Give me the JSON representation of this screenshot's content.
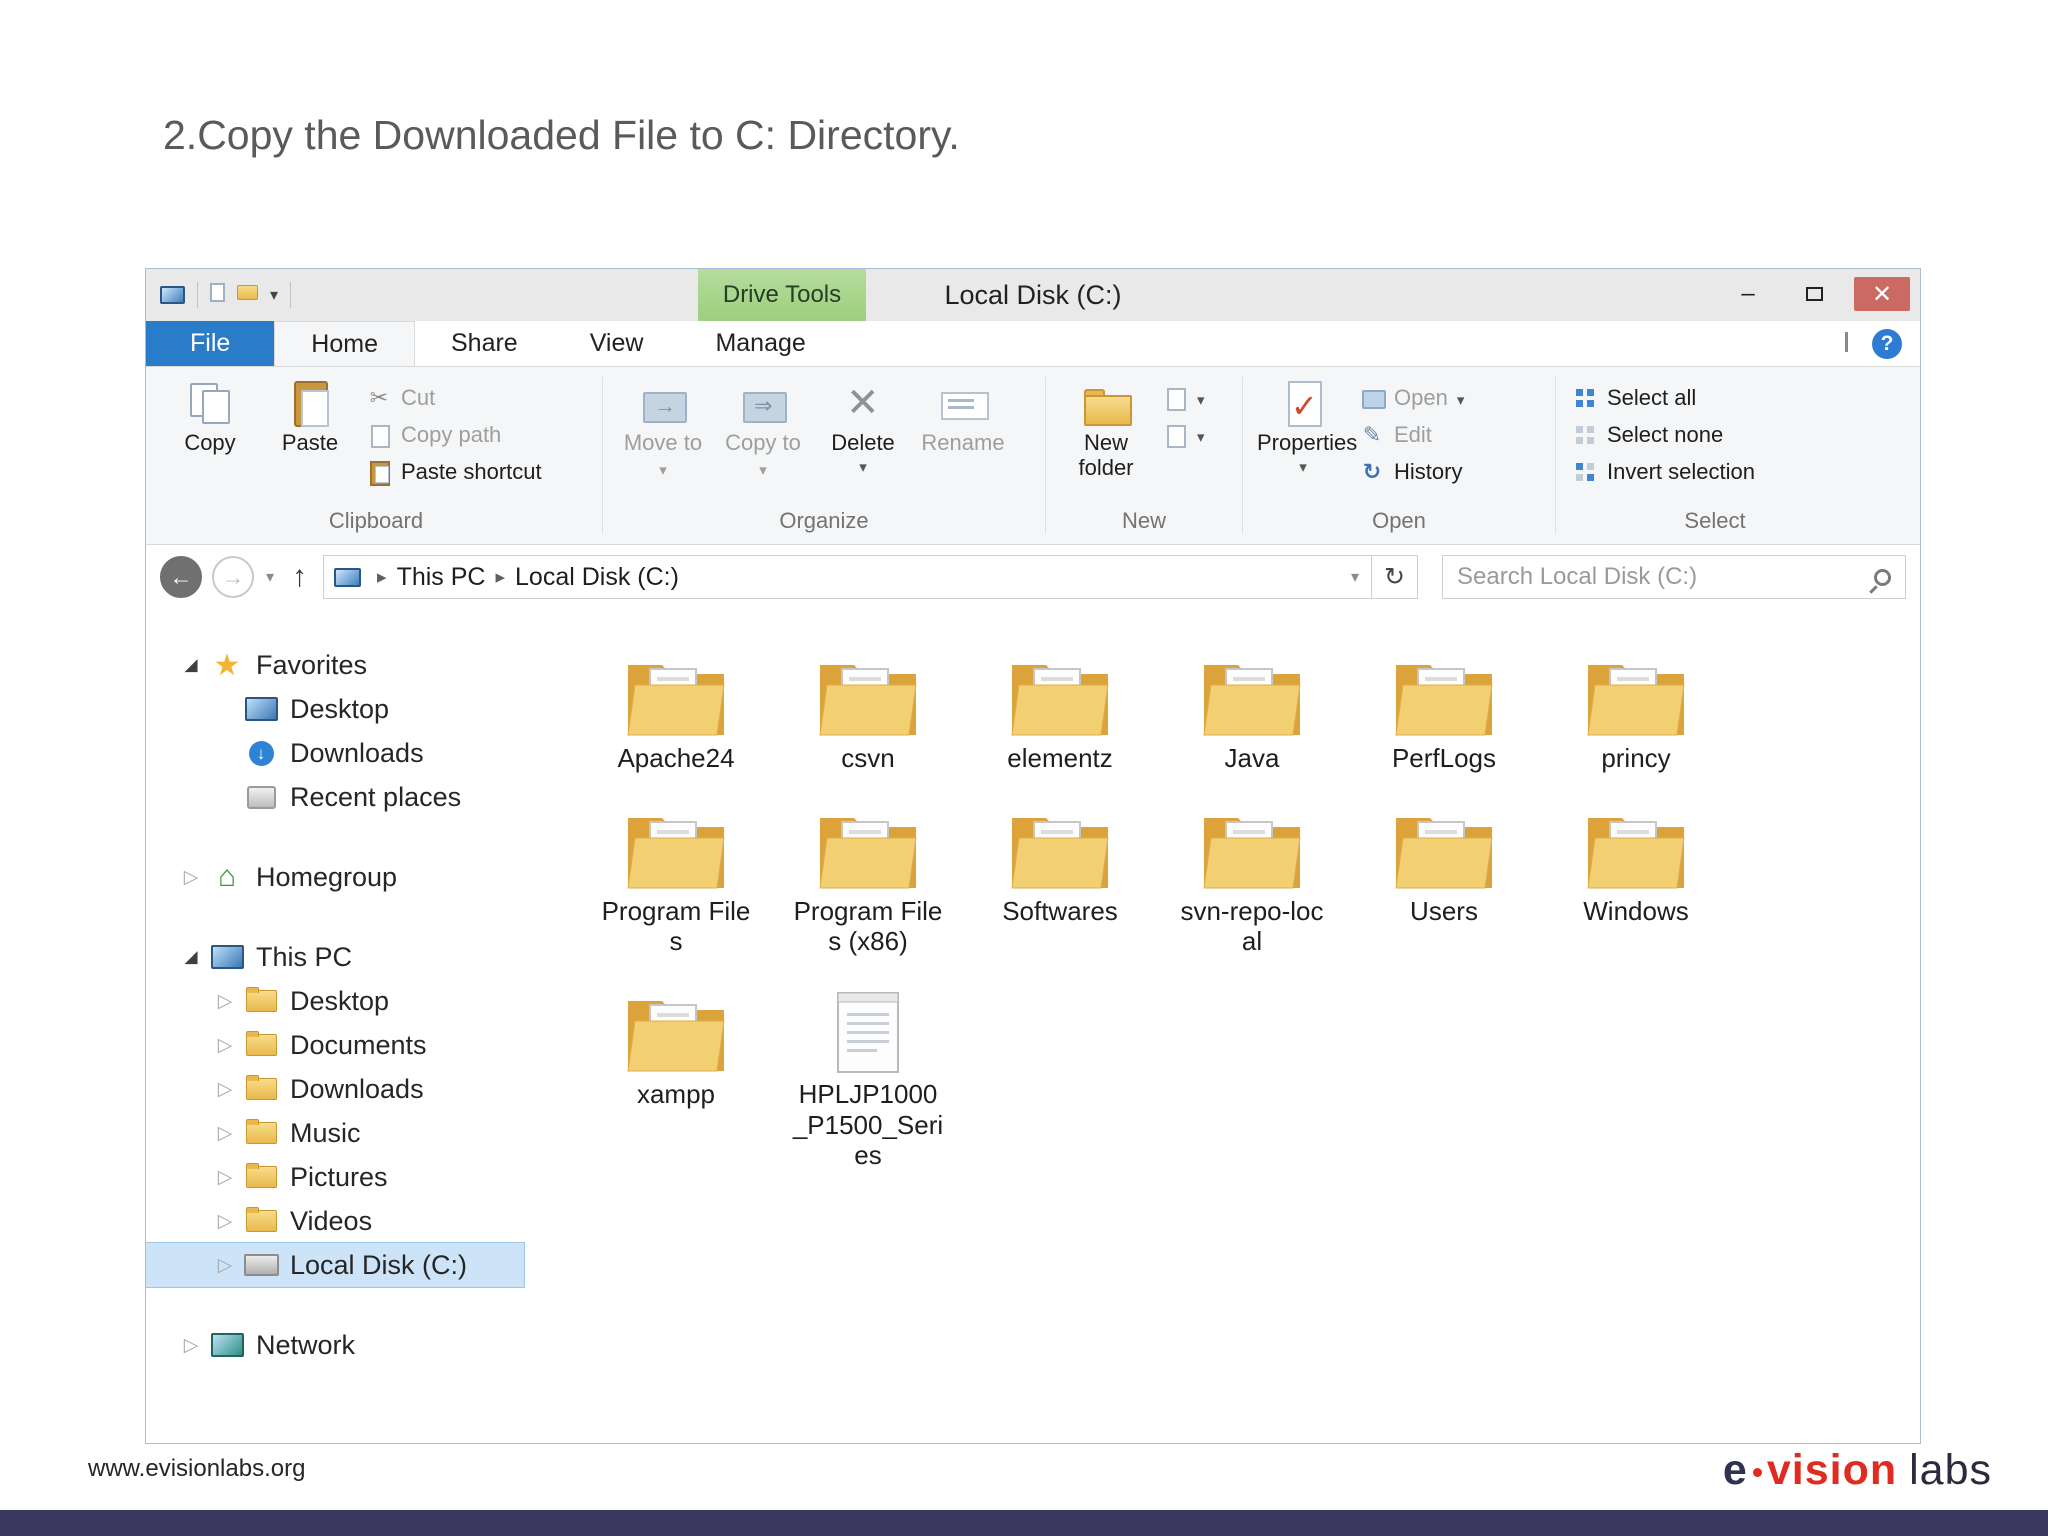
{
  "slide": {
    "title": "2.Copy the Downloaded File to C: Directory.",
    "footer_url": "www.evisionlabs.org",
    "logo": {
      "e": "e",
      "vision": "vision",
      "labs": "labs"
    }
  },
  "icons": {
    "dropdown": "▾",
    "back": "←",
    "forward": "→",
    "up": "↑",
    "refresh": "↻",
    "minimize": "–",
    "close": "✕",
    "help": "?",
    "cut_glyph": "✂",
    "edit_glyph": "✎",
    "history_glyph": "↻"
  },
  "window": {
    "title": "Local Disk (C:)",
    "context_tab": "Drive Tools",
    "tabs": [
      {
        "label": "File",
        "style": "file"
      },
      {
        "label": "Home",
        "style": "active"
      },
      {
        "label": "Share",
        "style": "plain"
      },
      {
        "label": "View",
        "style": "plain"
      },
      {
        "label": "Manage",
        "style": "plain"
      }
    ],
    "ribbon": {
      "copy": "Copy",
      "paste": "Paste",
      "cut": "Cut",
      "copy_path": "Copy path",
      "paste_shortcut": "Paste shortcut",
      "clipboard_label": "Clipboard",
      "move_to": "Move to",
      "copy_to": "Copy to",
      "delete": "Delete",
      "rename": "Rename",
      "organize_label": "Organize",
      "new_folder": "New folder",
      "new_label": "New",
      "properties": "Properties",
      "open": "Open",
      "edit": "Edit",
      "history": "History",
      "open_label": "Open",
      "select_all": "Select all",
      "select_none": "Select none",
      "invert_selection": "Invert selection",
      "select_label": "Select"
    },
    "address": {
      "crumbs": [
        "This PC",
        "Local Disk (C:)"
      ],
      "search_placeholder": "Search Local Disk (C:)"
    },
    "sidebar": {
      "items": [
        {
          "label": "Favorites",
          "icon": "favorites-star",
          "level": 0,
          "expander": "expanded"
        },
        {
          "label": "Desktop",
          "icon": "desktop",
          "level": 1
        },
        {
          "label": "Downloads",
          "icon": "downloads",
          "level": 1
        },
        {
          "label": "Recent places",
          "icon": "recent-places",
          "level": 1
        },
        {
          "label": "Homegroup",
          "icon": "homegroup",
          "level": 0,
          "expander": "collapsed",
          "group_start": true
        },
        {
          "label": "This PC",
          "icon": "this-pc",
          "level": 0,
          "expander": "expanded",
          "group_start": true
        },
        {
          "label": "Desktop",
          "icon": "desktop-folder",
          "level": 1,
          "expander": "collapsed"
        },
        {
          "label": "Documents",
          "icon": "documents-folder",
          "level": 1,
          "expander": "collapsed"
        },
        {
          "label": "Downloads",
          "icon": "downloads-folder",
          "level": 1,
          "expander": "collapsed"
        },
        {
          "label": "Music",
          "icon": "music-folder",
          "level": 1,
          "expander": "collapsed"
        },
        {
          "label": "Pictures",
          "icon": "pictures-folder",
          "level": 1,
          "expander": "collapsed"
        },
        {
          "label": "Videos",
          "icon": "videos-folder",
          "level": 1,
          "expander": "collapsed"
        },
        {
          "label": "Local Disk (C:)",
          "icon": "drive",
          "level": 1,
          "expander": "collapsed",
          "selected": true
        },
        {
          "label": "Network",
          "icon": "network",
          "level": 0,
          "expander": "collapsed",
          "group_start": true
        }
      ]
    },
    "files": [
      {
        "name": "Apache24",
        "type": "folder"
      },
      {
        "name": "csvn",
        "type": "folder"
      },
      {
        "name": "elementz",
        "type": "folder"
      },
      {
        "name": "Java",
        "type": "folder"
      },
      {
        "name": "PerfLogs",
        "type": "folder"
      },
      {
        "name": "princy",
        "type": "folder"
      },
      {
        "name": "Program Files",
        "type": "folder"
      },
      {
        "name": "Program Files (x86)",
        "type": "folder"
      },
      {
        "name": "Softwares",
        "type": "folder"
      },
      {
        "name": "svn-repo-local",
        "type": "folder"
      },
      {
        "name": "Users",
        "type": "folder"
      },
      {
        "name": "Windows",
        "type": "folder"
      },
      {
        "name": "xampp",
        "type": "folder"
      },
      {
        "name": "HPLJP1000_P1500_Series",
        "type": "file"
      }
    ]
  }
}
